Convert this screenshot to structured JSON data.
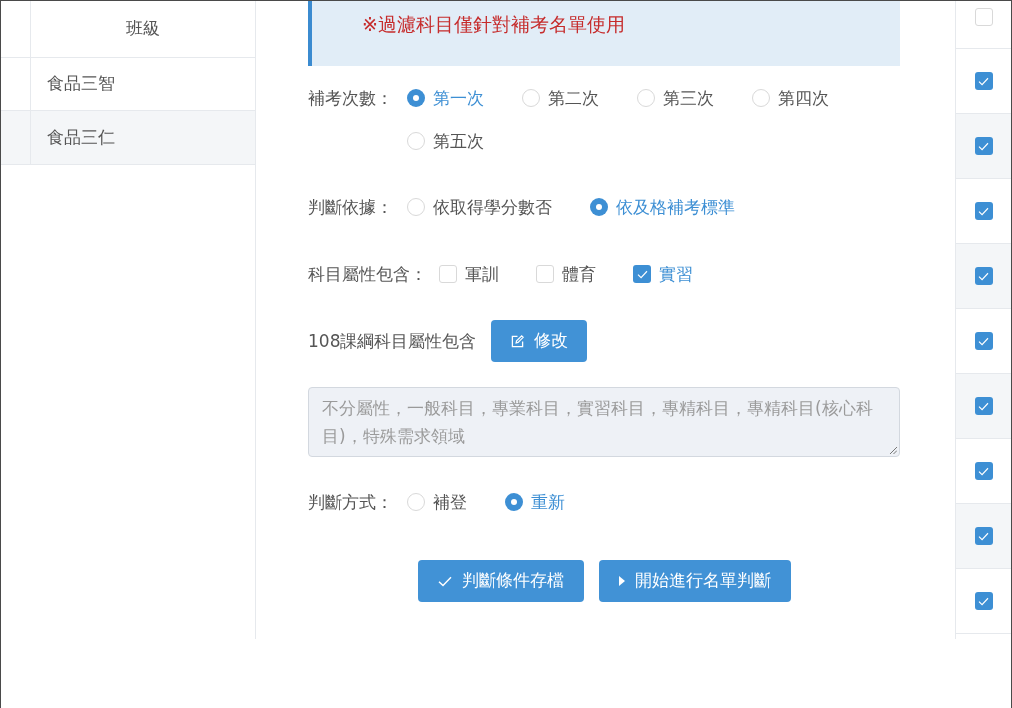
{
  "class_table": {
    "heading": "班級",
    "rows": [
      {
        "class": "食品三智"
      },
      {
        "class": "食品三仁"
      }
    ]
  },
  "notice": {
    "text": "※過濾科目僅針對補考名單使用"
  },
  "form": {
    "fields": [
      {
        "kind": "radio",
        "label": "補考次數：",
        "options": [
          {
            "label": "第一次",
            "selected": true
          },
          {
            "label": "第二次",
            "selected": false
          },
          {
            "label": "第三次",
            "selected": false
          },
          {
            "label": "第四次",
            "selected": false
          },
          {
            "label": "第五次",
            "selected": false
          }
        ]
      },
      {
        "kind": "radio",
        "label": "判斷依據：",
        "options": [
          {
            "label": "依取得學分數否",
            "selected": false
          },
          {
            "label": "依及格補考標準",
            "selected": true
          }
        ]
      },
      {
        "kind": "checkbox",
        "label": "科目屬性包含：",
        "options": [
          {
            "label": "軍訓",
            "checked": false
          },
          {
            "label": "體育",
            "checked": false
          },
          {
            "label": "實習",
            "checked": true
          }
        ]
      },
      {
        "kind": "edit",
        "label": "108課綱科目屬性包含",
        "button": "修改",
        "text_field": {
          "value": "不分屬性，一般科目，專業科目，實習科目，專精科目，專精科目(核心科目)，特殊需求領域",
          "disabled": true
        }
      },
      {
        "kind": "radio",
        "label": "判斷方式：",
        "options": [
          {
            "label": "補登",
            "selected": false
          },
          {
            "label": "重新",
            "selected": true
          }
        ]
      }
    ]
  },
  "actions": [
    {
      "kind": "save",
      "label": "判斷條件存檔"
    },
    {
      "kind": "run",
      "label": "開始進行名單判斷"
    }
  ],
  "select_column": {
    "header": {
      "checked": false
    },
    "rows": [
      {
        "checked": true
      },
      {
        "checked": true
      },
      {
        "checked": true
      },
      {
        "checked": true
      },
      {
        "checked": true
      },
      {
        "checked": true
      },
      {
        "checked": true
      },
      {
        "checked": true
      },
      {
        "checked": true
      }
    ]
  }
}
